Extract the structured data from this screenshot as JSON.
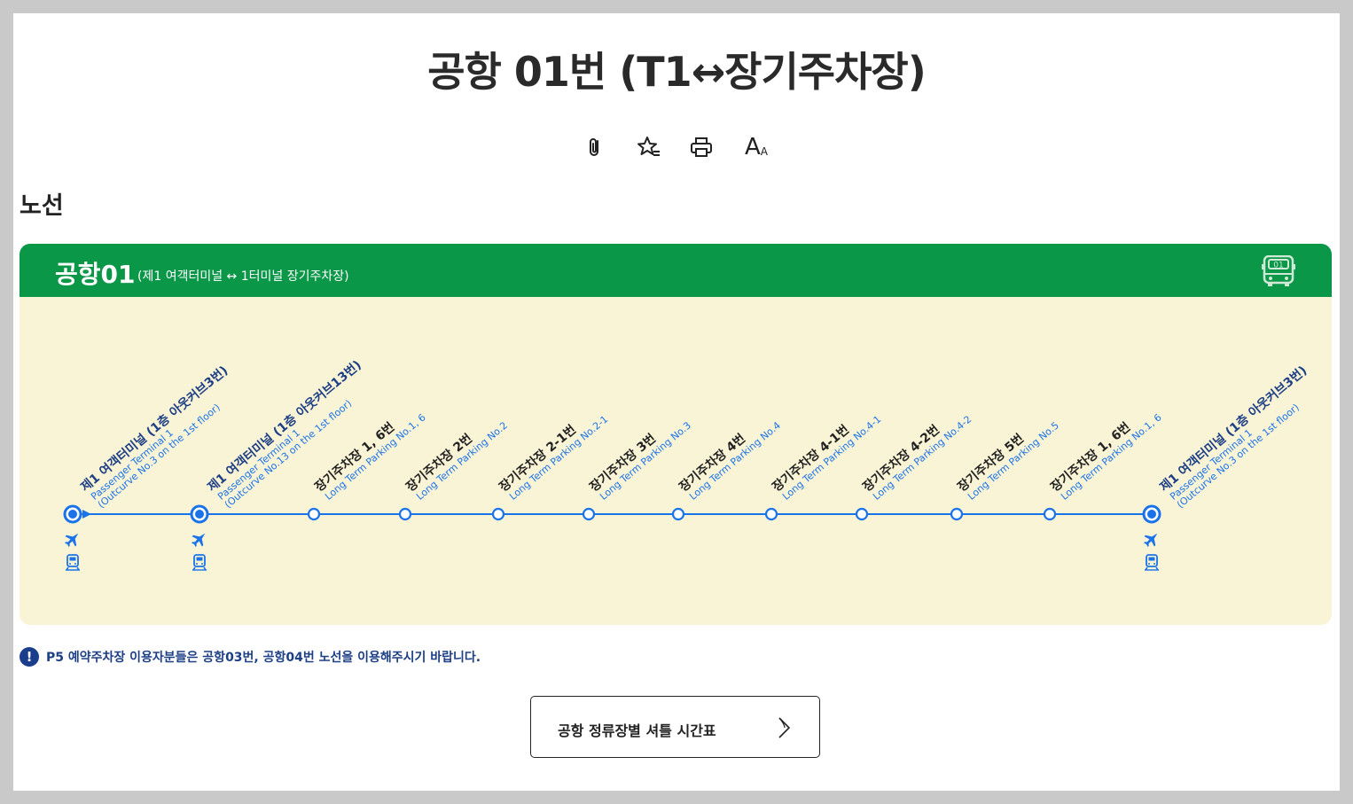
{
  "page": {
    "title": "공항 01번 (T1↔장기주차장)",
    "section_title": "노선"
  },
  "toolbar": {
    "icons": [
      "attach-icon",
      "favorite-icon",
      "print-icon",
      "font-size-icon"
    ],
    "font_size_label": "A",
    "font_size_small": "A"
  },
  "route": {
    "name": "공항01",
    "description": "(제1 여객터미널 ↔ 1터미널 장기주차장)",
    "badge": "01",
    "colors": {
      "header": "#0a9748",
      "line": "#1a73e8",
      "background": "#faf4d7",
      "stop_text": "#1d3f85"
    },
    "stops": [
      {
        "name": "제1 여객터미널 (1층 아웃커브3번)",
        "en1": "Passenger Terminal 1",
        "en2": "(Outcurve No.3 on the 1st floor)",
        "major": true,
        "airport": true,
        "train": true,
        "start": true
      },
      {
        "name": "제1 여객터미널 (1층 아웃커브13번)",
        "en1": "Passenger Terminal 1",
        "en2": "(Outcurve No.13 on the 1st floor)",
        "major": true,
        "airport": true,
        "train": true
      },
      {
        "name": "장기주차장 1, 6번",
        "en1": "Long Term Parking No.1, 6",
        "en2": "",
        "major": false
      },
      {
        "name": "장기주차장 2번",
        "en1": "Long Term Parking No.2",
        "en2": "",
        "major": false
      },
      {
        "name": "장기주차장 2-1번",
        "en1": "Long Term Parking No.2-1",
        "en2": "",
        "major": false
      },
      {
        "name": "장기주차장 3번",
        "en1": "Long Term Parking No.3",
        "en2": "",
        "major": false
      },
      {
        "name": "장기주차장 4번",
        "en1": "Long Term Parking No.4",
        "en2": "",
        "major": false
      },
      {
        "name": "장기주차장 4-1번",
        "en1": "Long Term Parking No.4-1",
        "en2": "",
        "major": false
      },
      {
        "name": "장기주차장 4-2번",
        "en1": "Long Term Parking No.4-2",
        "en2": "",
        "major": false
      },
      {
        "name": "장기주차장 5번",
        "en1": "Long Term Parking No.5",
        "en2": "",
        "major": false
      },
      {
        "name": "장기주차장 1, 6번",
        "en1": "Long Term Parking No.1, 6",
        "en2": "",
        "major": false
      },
      {
        "name": "제1 여객터미널 (1층 아웃커브3번)",
        "en1": "Passenger Terminal 1",
        "en2": "(Outcurve No.3 on the 1st floor)",
        "major": true,
        "airport": true,
        "train": true
      }
    ]
  },
  "notice": {
    "icon": "!",
    "text": "P5 예약주차장 이용자분들은 공항03번, 공항04번 노선을 이용해주시기 바랍니다."
  },
  "timetable_button": {
    "label": "공항 정류장별 셔틀 시간표"
  }
}
